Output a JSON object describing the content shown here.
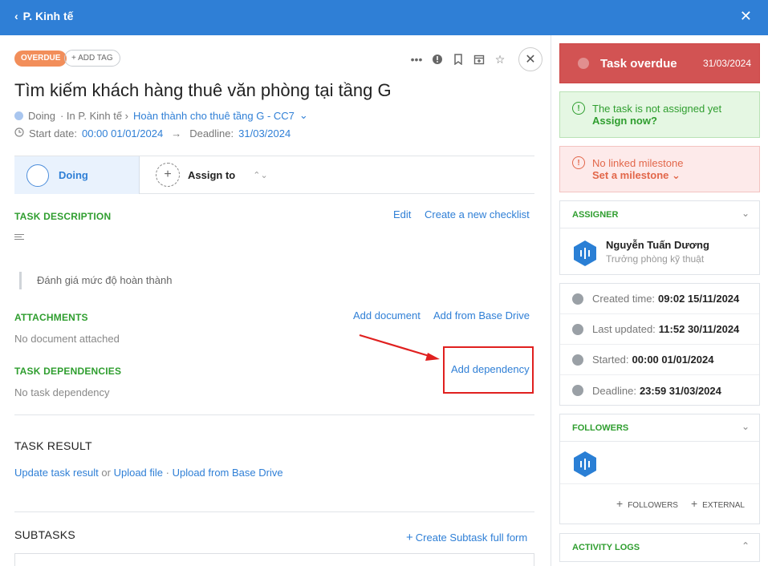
{
  "topbar": {
    "back_label": "P. Kinh tế",
    "close_label": "✕"
  },
  "header": {
    "overdue_tag": "OVERDUE",
    "add_tag": "+ ADD TAG",
    "title": "Tìm kiếm khách hàng thuê văn phòng tại tầng G",
    "status_text": "Doing",
    "breadcrumb_sep": "· In P. Kinh tế ›",
    "project_link": "Hoàn thành cho thuê tầng G - CC7",
    "start_label": "Start date:",
    "start_value": "00:00 01/01/2024",
    "deadline_label": "Deadline:",
    "deadline_value": "31/03/2024"
  },
  "status_row": {
    "status": "Doing",
    "assign_label": "Assign to"
  },
  "description": {
    "heading": "TASK DESCRIPTION",
    "edit": "Edit",
    "checklist": "Create a new checklist",
    "quote": "Đánh giá mức độ hoàn thành"
  },
  "attachments": {
    "heading": "ATTACHMENTS",
    "add_document": "Add document",
    "add_drive": "Add from Base Drive",
    "empty": "No document attached"
  },
  "dependencies": {
    "heading": "TASK DEPENDENCIES",
    "add": "Add dependency",
    "empty": "No task dependency"
  },
  "result": {
    "heading": "TASK RESULT",
    "update": "Update task result",
    "or": " or ",
    "upload": "Upload file",
    "dot": " · ",
    "upload_drive": "Upload from Base Drive"
  },
  "subtasks": {
    "heading": "SUBTASKS",
    "create": "Create Subtask full form"
  },
  "right": {
    "overdue": {
      "title": "Task overdue",
      "date": "31/03/2024"
    },
    "not_assigned": {
      "line1": "The task is not assigned yet",
      "line2": "Assign now?"
    },
    "milestone": {
      "line1": "No linked milestone",
      "line2": "Set a milestone ⌄"
    },
    "assigner": {
      "heading": "ASSIGNER",
      "name": "Nguyễn Tuấn Dương",
      "role": "Trưởng phòng kỹ thuật"
    },
    "times": [
      {
        "label": "Created time:",
        "value": "09:02 15/11/2024"
      },
      {
        "label": "Last updated:",
        "value": "11:52 30/11/2024"
      },
      {
        "label": "Started:",
        "value": "00:00 01/01/2024"
      },
      {
        "label": "Deadline:",
        "value": "23:59 31/03/2024"
      }
    ],
    "followers": {
      "heading": "FOLLOWERS",
      "add_followers": "FOLLOWERS",
      "add_external": "EXTERNAL"
    },
    "logs": {
      "heading": "ACTIVITY LOGS"
    }
  },
  "colors": {
    "primary": "#2f7fd6",
    "section_green": "#2f9e2f",
    "overdue_tag": "#f28e5a",
    "overdue_card": "#d25353",
    "highlight_red": "#e0201f"
  }
}
